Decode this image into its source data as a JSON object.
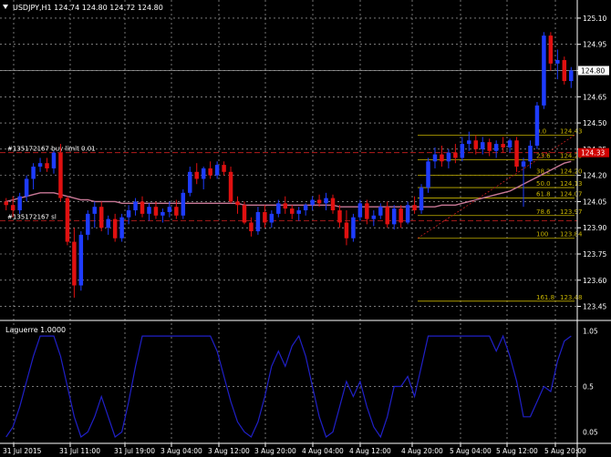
{
  "header": {
    "symbol_line": "USDJPY,H1  124.74 124.80 124.72 124.80",
    "collapse_icon": "triangle-down-icon"
  },
  "colors": {
    "background": "#000000",
    "grid": "#c0c0c0",
    "axis_text": "#ffffff",
    "bull": "#1e3cff",
    "bear": "#e01010",
    "moving_average": "#c87896",
    "fib": "#c8b400",
    "order_line": "#d02020",
    "indicator": "#2020c8",
    "current_price_label_bg": "#ffffff",
    "order_label_bg": "#d00000"
  },
  "order_lines": [
    {
      "label": "#135172167 buy limit 0.01",
      "price": 124.33
    },
    {
      "label": "#135172167 sl",
      "price": 123.94
    }
  ],
  "current_price_label": "124.80",
  "order_price_label": "124.33",
  "chart_data": [
    {
      "type": "candlestick",
      "title": "USDJPY,H1",
      "ylim": [
        123.38,
        125.11
      ],
      "y_ticks": [
        "125.10",
        "124.95",
        "124.80",
        "124.65",
        "124.50",
        "124.35",
        "124.20",
        "124.05",
        "123.90",
        "123.75",
        "123.60",
        "123.45"
      ],
      "x_ticks": [
        "31 Jul 2015",
        "31 Jul 11:00",
        "31 Jul 19:00",
        "3 Aug 04:00",
        "3 Aug 12:00",
        "3 Aug 20:00",
        "4 Aug 04:00",
        "4 Aug 12:00",
        "4 Aug 20:00",
        "5 Aug 04:00",
        "5 Aug 12:00",
        "5 Aug 20:00"
      ],
      "candles": [
        {
          "o": 124.05,
          "h": 124.07,
          "l": 124.0,
          "c": 124.03
        },
        {
          "o": 124.03,
          "h": 124.08,
          "l": 123.96,
          "c": 124.0
        },
        {
          "o": 124.0,
          "h": 124.1,
          "l": 123.98,
          "c": 124.08
        },
        {
          "o": 124.08,
          "h": 124.2,
          "l": 124.05,
          "c": 124.18
        },
        {
          "o": 124.18,
          "h": 124.27,
          "l": 124.12,
          "c": 124.25
        },
        {
          "o": 124.25,
          "h": 124.3,
          "l": 124.22,
          "c": 124.27
        },
        {
          "o": 124.27,
          "h": 124.3,
          "l": 124.22,
          "c": 124.24
        },
        {
          "o": 124.24,
          "h": 124.34,
          "l": 124.21,
          "c": 124.33
        },
        {
          "o": 124.33,
          "h": 124.38,
          "l": 124.05,
          "c": 124.07
        },
        {
          "o": 124.07,
          "h": 124.08,
          "l": 123.8,
          "c": 123.82
        },
        {
          "o": 123.82,
          "h": 123.9,
          "l": 123.5,
          "c": 123.57
        },
        {
          "o": 123.57,
          "h": 123.88,
          "l": 123.54,
          "c": 123.86
        },
        {
          "o": 123.86,
          "h": 124.0,
          "l": 123.83,
          "c": 123.98
        },
        {
          "o": 123.98,
          "h": 124.05,
          "l": 123.9,
          "c": 124.02
        },
        {
          "o": 124.02,
          "h": 124.05,
          "l": 123.88,
          "c": 123.9
        },
        {
          "o": 123.9,
          "h": 123.97,
          "l": 123.86,
          "c": 123.95
        },
        {
          "o": 123.95,
          "h": 123.98,
          "l": 123.82,
          "c": 123.84
        },
        {
          "o": 123.84,
          "h": 123.98,
          "l": 123.82,
          "c": 123.96
        },
        {
          "o": 123.96,
          "h": 124.03,
          "l": 123.92,
          "c": 124.0
        },
        {
          "o": 124.0,
          "h": 124.07,
          "l": 123.97,
          "c": 124.05
        },
        {
          "o": 124.05,
          "h": 124.08,
          "l": 123.96,
          "c": 123.98
        },
        {
          "o": 123.98,
          "h": 124.04,
          "l": 123.94,
          "c": 124.02
        },
        {
          "o": 124.02,
          "h": 124.05,
          "l": 123.95,
          "c": 123.97
        },
        {
          "o": 123.97,
          "h": 124.01,
          "l": 123.93,
          "c": 123.99
        },
        {
          "o": 123.99,
          "h": 124.05,
          "l": 123.96,
          "c": 124.02
        },
        {
          "o": 124.02,
          "h": 124.06,
          "l": 123.95,
          "c": 123.97
        },
        {
          "o": 123.97,
          "h": 124.12,
          "l": 123.95,
          "c": 124.1
        },
        {
          "o": 124.1,
          "h": 124.25,
          "l": 124.08,
          "c": 124.22
        },
        {
          "o": 124.22,
          "h": 124.27,
          "l": 124.15,
          "c": 124.18
        },
        {
          "o": 124.18,
          "h": 124.25,
          "l": 124.12,
          "c": 124.24
        },
        {
          "o": 124.24,
          "h": 124.28,
          "l": 124.18,
          "c": 124.2
        },
        {
          "o": 124.2,
          "h": 124.28,
          "l": 124.18,
          "c": 124.26
        },
        {
          "o": 124.26,
          "h": 124.28,
          "l": 124.2,
          "c": 124.22
        },
        {
          "o": 124.22,
          "h": 124.25,
          "l": 124.04,
          "c": 124.05
        },
        {
          "o": 124.05,
          "h": 124.08,
          "l": 123.98,
          "c": 124.03
        },
        {
          "o": 124.03,
          "h": 124.05,
          "l": 123.92,
          "c": 123.93
        },
        {
          "o": 123.93,
          "h": 123.96,
          "l": 123.85,
          "c": 123.88
        },
        {
          "o": 123.88,
          "h": 124.02,
          "l": 123.86,
          "c": 123.99
        },
        {
          "o": 123.99,
          "h": 124.03,
          "l": 123.9,
          "c": 123.93
        },
        {
          "o": 123.93,
          "h": 124.0,
          "l": 123.9,
          "c": 123.98
        },
        {
          "o": 123.98,
          "h": 124.06,
          "l": 123.96,
          "c": 124.04
        },
        {
          "o": 124.04,
          "h": 124.08,
          "l": 123.98,
          "c": 124.01
        },
        {
          "o": 124.01,
          "h": 124.03,
          "l": 123.95,
          "c": 123.98
        },
        {
          "o": 123.98,
          "h": 124.02,
          "l": 123.94,
          "c": 124.0
        },
        {
          "o": 124.0,
          "h": 124.04,
          "l": 123.97,
          "c": 124.03
        },
        {
          "o": 124.03,
          "h": 124.08,
          "l": 124.0,
          "c": 124.06
        },
        {
          "o": 124.06,
          "h": 124.09,
          "l": 124.02,
          "c": 124.04
        },
        {
          "o": 124.04,
          "h": 124.1,
          "l": 124.0,
          "c": 124.07
        },
        {
          "o": 124.07,
          "h": 124.09,
          "l": 123.98,
          "c": 124.0
        },
        {
          "o": 124.0,
          "h": 124.03,
          "l": 123.9,
          "c": 123.93
        },
        {
          "o": 123.93,
          "h": 124.0,
          "l": 123.8,
          "c": 123.84
        },
        {
          "o": 123.84,
          "h": 123.98,
          "l": 123.82,
          "c": 123.96
        },
        {
          "o": 123.96,
          "h": 124.06,
          "l": 123.94,
          "c": 124.04
        },
        {
          "o": 124.04,
          "h": 124.06,
          "l": 123.92,
          "c": 123.95
        },
        {
          "o": 123.95,
          "h": 124.0,
          "l": 123.91,
          "c": 123.97
        },
        {
          "o": 123.97,
          "h": 124.04,
          "l": 123.95,
          "c": 124.02
        },
        {
          "o": 124.02,
          "h": 124.05,
          "l": 123.9,
          "c": 123.92
        },
        {
          "o": 123.92,
          "h": 124.03,
          "l": 123.89,
          "c": 124.01
        },
        {
          "o": 124.01,
          "h": 124.03,
          "l": 123.9,
          "c": 123.93
        },
        {
          "o": 123.93,
          "h": 124.05,
          "l": 123.92,
          "c": 124.03
        },
        {
          "o": 124.03,
          "h": 124.08,
          "l": 123.98,
          "c": 124.0
        },
        {
          "o": 124.0,
          "h": 124.15,
          "l": 123.98,
          "c": 124.13
        },
        {
          "o": 124.13,
          "h": 124.3,
          "l": 124.1,
          "c": 124.28
        },
        {
          "o": 124.28,
          "h": 124.36,
          "l": 124.24,
          "c": 124.32
        },
        {
          "o": 124.32,
          "h": 124.37,
          "l": 124.25,
          "c": 124.28
        },
        {
          "o": 124.28,
          "h": 124.35,
          "l": 124.24,
          "c": 124.33
        },
        {
          "o": 124.33,
          "h": 124.38,
          "l": 124.27,
          "c": 124.3
        },
        {
          "o": 124.3,
          "h": 124.42,
          "l": 124.28,
          "c": 124.38
        },
        {
          "o": 124.38,
          "h": 124.45,
          "l": 124.34,
          "c": 124.4
        },
        {
          "o": 124.4,
          "h": 124.43,
          "l": 124.32,
          "c": 124.35
        },
        {
          "o": 124.35,
          "h": 124.42,
          "l": 124.32,
          "c": 124.39
        },
        {
          "o": 124.39,
          "h": 124.41,
          "l": 124.31,
          "c": 124.34
        },
        {
          "o": 124.34,
          "h": 124.4,
          "l": 124.3,
          "c": 124.38
        },
        {
          "o": 124.38,
          "h": 124.42,
          "l": 124.33,
          "c": 124.36
        },
        {
          "o": 124.36,
          "h": 124.41,
          "l": 124.33,
          "c": 124.4
        },
        {
          "o": 124.4,
          "h": 124.42,
          "l": 124.22,
          "c": 124.25
        },
        {
          "o": 124.25,
          "h": 124.3,
          "l": 124.02,
          "c": 124.28
        },
        {
          "o": 124.28,
          "h": 124.4,
          "l": 124.24,
          "c": 124.37
        },
        {
          "o": 124.37,
          "h": 124.62,
          "l": 124.35,
          "c": 124.6
        },
        {
          "o": 124.6,
          "h": 125.02,
          "l": 124.58,
          "c": 125.0
        },
        {
          "o": 125.0,
          "h": 125.02,
          "l": 124.8,
          "c": 124.84
        },
        {
          "o": 124.84,
          "h": 124.92,
          "l": 124.75,
          "c": 124.86
        },
        {
          "o": 124.86,
          "h": 124.88,
          "l": 124.72,
          "c": 124.74
        },
        {
          "o": 124.74,
          "h": 124.82,
          "l": 124.7,
          "c": 124.8
        }
      ],
      "moving_average": [
        124.05,
        124.06,
        124.07,
        124.08,
        124.09,
        124.1,
        124.1,
        124.1,
        124.09,
        124.08,
        124.07,
        124.06,
        124.06,
        124.05,
        124.05,
        124.05,
        124.05,
        124.04,
        124.04,
        124.04,
        124.04,
        124.04,
        124.04,
        124.04,
        124.04,
        124.04,
        124.04,
        124.04,
        124.04,
        124.04,
        124.04,
        124.04,
        124.04,
        124.04,
        124.04,
        124.03,
        124.03,
        124.03,
        124.03,
        124.03,
        124.03,
        124.03,
        124.03,
        124.03,
        124.03,
        124.03,
        124.03,
        124.03,
        124.03,
        124.02,
        124.02,
        124.02,
        124.02,
        124.02,
        124.02,
        124.02,
        124.02,
        124.02,
        124.02,
        124.02,
        124.02,
        124.02,
        124.02,
        124.02,
        124.03,
        124.03,
        124.03,
        124.04,
        124.05,
        124.06,
        124.07,
        124.08,
        124.09,
        124.1,
        124.11,
        124.13,
        124.15,
        124.17,
        124.19,
        124.21,
        124.23,
        124.25,
        124.27,
        124.28
      ],
      "fibonacci": {
        "levels": [
          {
            "ratio": "0.0",
            "price": 124.43
          },
          {
            "ratio": "23.6",
            "price": 124.29
          },
          {
            "ratio": "38.2",
            "price": 124.2
          },
          {
            "ratio": "50.0",
            "price": 124.13
          },
          {
            "ratio": "61.8",
            "price": 124.07
          },
          {
            "ratio": "78.6",
            "price": 123.97
          },
          {
            "ratio": "100",
            "price": 123.84
          },
          {
            "ratio": "161.8",
            "price": 123.48
          }
        ]
      }
    },
    {
      "type": "line",
      "title": "Laguerre 1.0000",
      "ylim": [
        0,
        1.1
      ],
      "y_ticks": [
        "1.05",
        "0.5",
        "0.05"
      ],
      "values": [
        0.0,
        0.1,
        0.3,
        0.55,
        0.8,
        1.0,
        1.0,
        1.0,
        0.8,
        0.5,
        0.2,
        0.0,
        0.05,
        0.2,
        0.4,
        0.2,
        0.0,
        0.05,
        0.35,
        0.7,
        1.0,
        1.0,
        1.0,
        1.0,
        1.0,
        1.0,
        1.0,
        1.0,
        1.0,
        1.0,
        1.0,
        0.85,
        0.6,
        0.35,
        0.15,
        0.05,
        0.0,
        0.15,
        0.4,
        0.7,
        0.85,
        0.7,
        0.9,
        1.0,
        0.8,
        0.5,
        0.2,
        0.0,
        0.05,
        0.3,
        0.55,
        0.4,
        0.55,
        0.3,
        0.1,
        0.0,
        0.2,
        0.5,
        0.5,
        0.6,
        0.4,
        0.7,
        1.0,
        1.0,
        1.0,
        1.0,
        1.0,
        1.0,
        1.0,
        1.0,
        1.0,
        1.0,
        0.85,
        1.0,
        0.8,
        0.55,
        0.2,
        0.2,
        0.35,
        0.5,
        0.45,
        0.75,
        0.95,
        1.0
      ]
    }
  ]
}
